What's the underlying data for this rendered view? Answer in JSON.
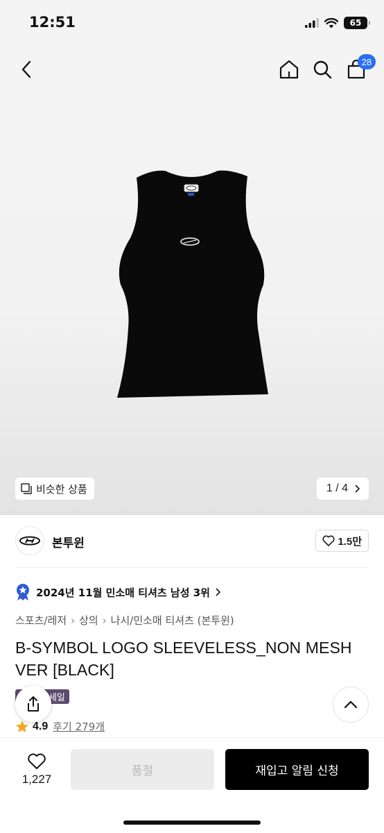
{
  "status_bar": {
    "time": "12:51",
    "battery": "65"
  },
  "header": {
    "cart_count": "28"
  },
  "gallery": {
    "similar_label": "비슷한 상품",
    "counter": "1 / 4"
  },
  "brand": {
    "name": "본투윈",
    "likes": "1.5만"
  },
  "ranking": {
    "text": "2024년 11월 민소매 티셔츠 남성 3위"
  },
  "breadcrumb": [
    "스포츠/레저",
    "상의",
    "나시/민소매 티셔츠 (본투윈)"
  ],
  "product": {
    "title": "B-SYMBOL LOGO SLEEVELESS_NON MESH VER [BLACK]",
    "sale_badge": "상세일",
    "rating": "4.9",
    "reviews": "후기 279개"
  },
  "bottom_bar": {
    "wish_count": "1,227",
    "soldout_label": "품절",
    "restock_label": "재입고 알림 신청"
  },
  "colors": {
    "accent": "#2a6ff2",
    "rank_badge": "#2f5bd6",
    "star": "#f5a623",
    "sale_badge": "#5b4b6e"
  },
  "icons": [
    "back-arrow-icon",
    "home-icon",
    "search-icon",
    "cart-icon",
    "similar-icon",
    "chevron-right-icon",
    "heart-icon",
    "medal-icon",
    "star-icon",
    "share-icon",
    "chevron-up-icon"
  ]
}
